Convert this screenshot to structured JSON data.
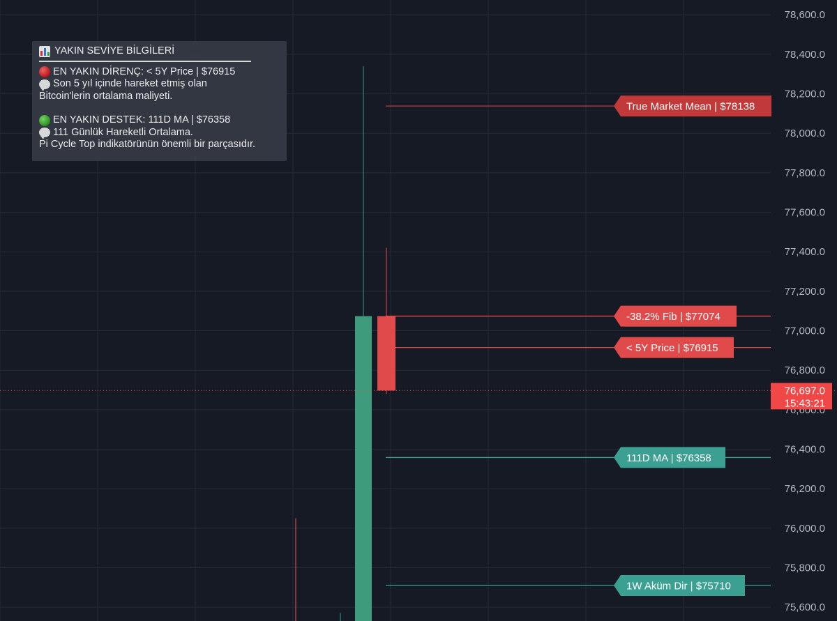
{
  "info_box": {
    "title": "YAKIN SEVİYE BİLGİLERİ",
    "resistance_line": "EN YAKIN DİRENÇ: < 5Y Price | $76915",
    "resistance_note_1": "Son 5 yıl içinde hareket etmiş olan",
    "resistance_note_2": "Bitcoin'lerin ortalama maliyeti.",
    "support_line": "EN YAKIN DESTEK: 111D MA | $76358",
    "support_note_1": "111 Günlük Hareketli Ortalama.",
    "support_note_2": "Pi Cycle Top indikatörünün önemli bir parçasıdır.",
    "icons": [
      "bar-chart-icon",
      "red-circle-icon",
      "speech-bubble-icon",
      "green-circle-icon",
      "speech-bubble-icon"
    ]
  },
  "chart_data": {
    "type": "candlestick",
    "ylim": [
      75530,
      78675
    ],
    "y_ticks": [
      {
        "value": 78600,
        "label": "78,600.0"
      },
      {
        "value": 78400,
        "label": "78,400.0"
      },
      {
        "value": 78200,
        "label": "78,200.0"
      },
      {
        "value": 78000,
        "label": "78,000.0"
      },
      {
        "value": 77800,
        "label": "77,800.0"
      },
      {
        "value": 77600,
        "label": "77,600.0"
      },
      {
        "value": 77400,
        "label": "77,400.0"
      },
      {
        "value": 77200,
        "label": "77,200.0"
      },
      {
        "value": 77000,
        "label": "77,000.0"
      },
      {
        "value": 76800,
        "label": "76,800.0"
      },
      {
        "value": 76600,
        "label": "76,600.0"
      },
      {
        "value": 76400,
        "label": "76,400.0"
      },
      {
        "value": 76200,
        "label": "76,200.0"
      },
      {
        "value": 76000,
        "label": "76,000.0"
      },
      {
        "value": 75800,
        "label": "75,800.0"
      },
      {
        "value": 75600,
        "label": "75,600.0"
      }
    ],
    "candles": [
      {
        "open": 76050,
        "close": 76030,
        "high": 76050,
        "low": 75500,
        "color": "#ef5350",
        "body": false
      },
      {
        "open": 75500,
        "close": 75500,
        "high": 75570,
        "low": 75500,
        "color": "#26a69a",
        "body": false
      },
      {
        "open": 75500,
        "close": 77074,
        "high": 78340,
        "low": 75500,
        "color": "#3e9b7c",
        "body": true
      },
      {
        "open": 77074,
        "close": 76697,
        "high": 77420,
        "low": 76680,
        "color": "#e04a4a",
        "body": true
      }
    ],
    "levels": [
      {
        "label": "True Market Mean | $78138",
        "value": 78138,
        "color": "#c2393a"
      },
      {
        "label": "-38.2% Fib | $77074",
        "value": 77074,
        "color": "#e04a4a"
      },
      {
        "label": "< 5Y Price | $76915",
        "value": 76915,
        "color": "#e04a4a"
      },
      {
        "label": "111D MA | $76358",
        "value": 76358,
        "color": "#3b9f92"
      },
      {
        "label": "1W Aküm Dir | $75710",
        "value": 75710,
        "color": "#3b9f92"
      }
    ],
    "current_price": {
      "value": 76697,
      "price_label": "76,697.0",
      "time_label": "15:43:21",
      "color": "#f24747"
    },
    "colors": {
      "background": "#161a25",
      "grid": "#252a36",
      "axis_text": "#b3b7c1"
    }
  }
}
